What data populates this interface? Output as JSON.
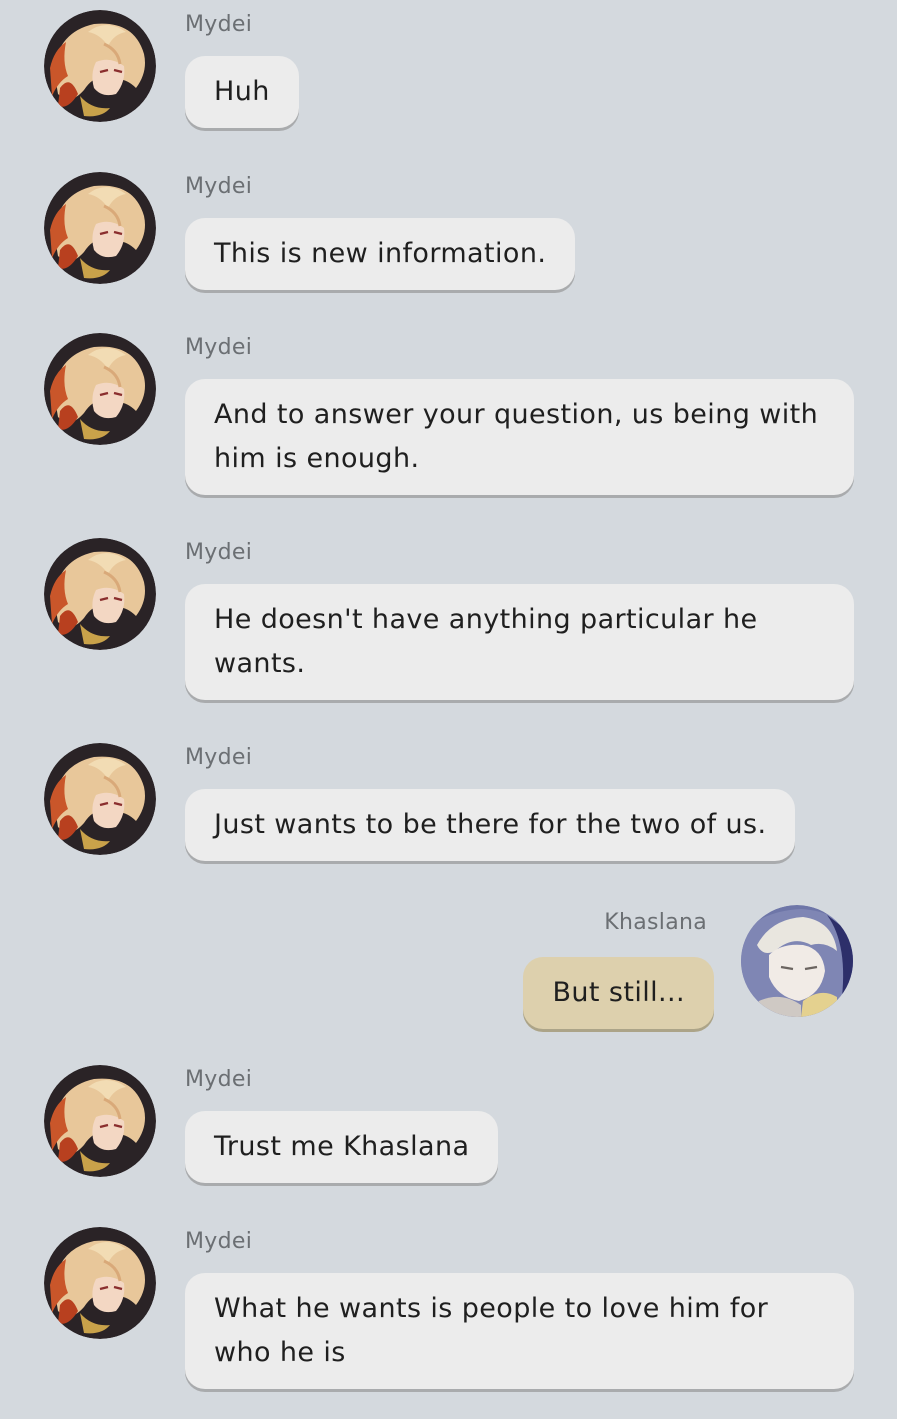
{
  "colors": {
    "background": "#d4d9de",
    "bubble_other": "#ececec",
    "bubble_self": "#ddd0ad",
    "name_text": "#6b6f73",
    "message_text": "#1f1f1f"
  },
  "messages": [
    {
      "sender": "Mydei",
      "avatar_icon": "mydei-avatar-icon",
      "text": "Huh"
    },
    {
      "sender": "Mydei",
      "avatar_icon": "mydei-avatar-icon",
      "text": "This is new information."
    },
    {
      "sender": "Mydei",
      "avatar_icon": "mydei-avatar-icon",
      "text": "And to answer your question, us being with him is enough."
    },
    {
      "sender": "Mydei",
      "avatar_icon": "mydei-avatar-icon",
      "text": "He doesn't have anything particular he wants."
    },
    {
      "sender": "Mydei",
      "avatar_icon": "mydei-avatar-icon",
      "text": "Just wants to be there for the two of us."
    },
    {
      "sender": "Khaslana",
      "avatar_icon": "khaslana-avatar-icon",
      "text": "But still..."
    },
    {
      "sender": "Mydei",
      "avatar_icon": "mydei-avatar-icon",
      "text": "Trust me Khaslana"
    },
    {
      "sender": "Mydei",
      "avatar_icon": "mydei-avatar-icon",
      "text": "What he wants is people to love him for who he is"
    }
  ]
}
